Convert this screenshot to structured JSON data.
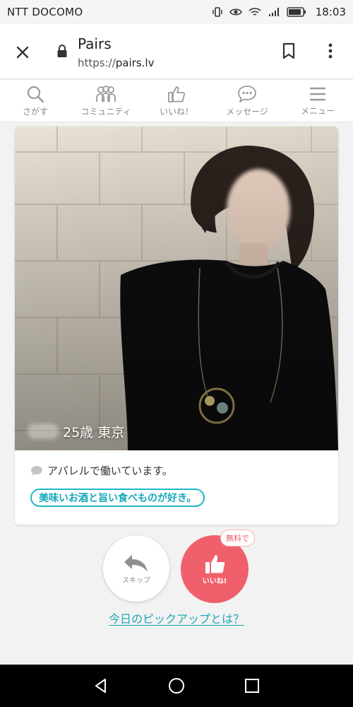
{
  "status_bar": {
    "carrier": "NTT DOCOMO",
    "time": "18:03"
  },
  "browser": {
    "title": "Pairs",
    "url_scheme": "https://",
    "url_host": "pairs.lv"
  },
  "nav": {
    "items": [
      {
        "label": "さがす",
        "icon": "search-icon"
      },
      {
        "label": "コミュニティ",
        "icon": "community-icon"
      },
      {
        "label": "いいね！",
        "icon": "thumbs-up-icon"
      },
      {
        "label": "メッセージ",
        "icon": "message-icon"
      },
      {
        "label": "メニュー",
        "icon": "menu-icon"
      }
    ]
  },
  "profile": {
    "caption": "25歳 東京",
    "bio": "アパレルで働いています。",
    "tag": "美味いお酒と旨い食べものが好き。"
  },
  "actions": {
    "skip_label": "スキップ",
    "like_label": "いいね!",
    "free_badge": "無料で",
    "pickup_link": "今日のピックアップとは？"
  },
  "colors": {
    "accent_teal": "#1aa7b7",
    "like_red": "#f0606c"
  }
}
